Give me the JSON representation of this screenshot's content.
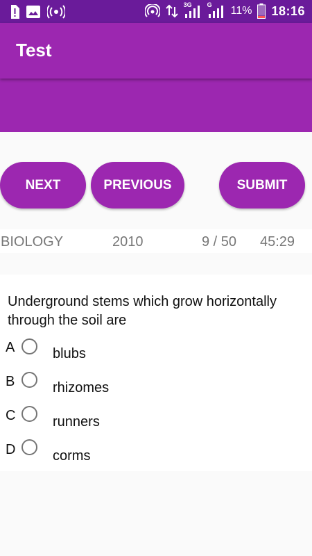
{
  "status_bar": {
    "battery_percent": "11%",
    "time": "18:16",
    "network_labels": [
      "3G",
      "G"
    ],
    "icons": [
      "sim-alert-icon",
      "image-icon",
      "broadcast-icon",
      "hotspot-icon",
      "data-transfer-icon",
      "signal-icon",
      "signal-icon",
      "battery-low-icon"
    ]
  },
  "app_bar": {
    "title": "Test"
  },
  "nav_buttons": {
    "next": "NEXT",
    "previous": "PREVIOUS",
    "submit": "SUBMIT"
  },
  "info_bar": {
    "subject": "BIOLOGY",
    "year": "2010",
    "progress": "9 / 50",
    "timer": "45:29"
  },
  "question": {
    "text": "Underground stems which grow horizontally through the soil are",
    "options": [
      {
        "letter": "A",
        "text": "blubs"
      },
      {
        "letter": "B",
        "text": "rhizomes"
      },
      {
        "letter": "C",
        "text": "runners"
      },
      {
        "letter": "D",
        "text": "corms"
      }
    ],
    "selected": null
  },
  "colors": {
    "primary": "#9c27b0",
    "primary_dark": "#6a1b9a",
    "background": "#fafafa",
    "info_text": "#777777",
    "radio_border": "#757575"
  }
}
